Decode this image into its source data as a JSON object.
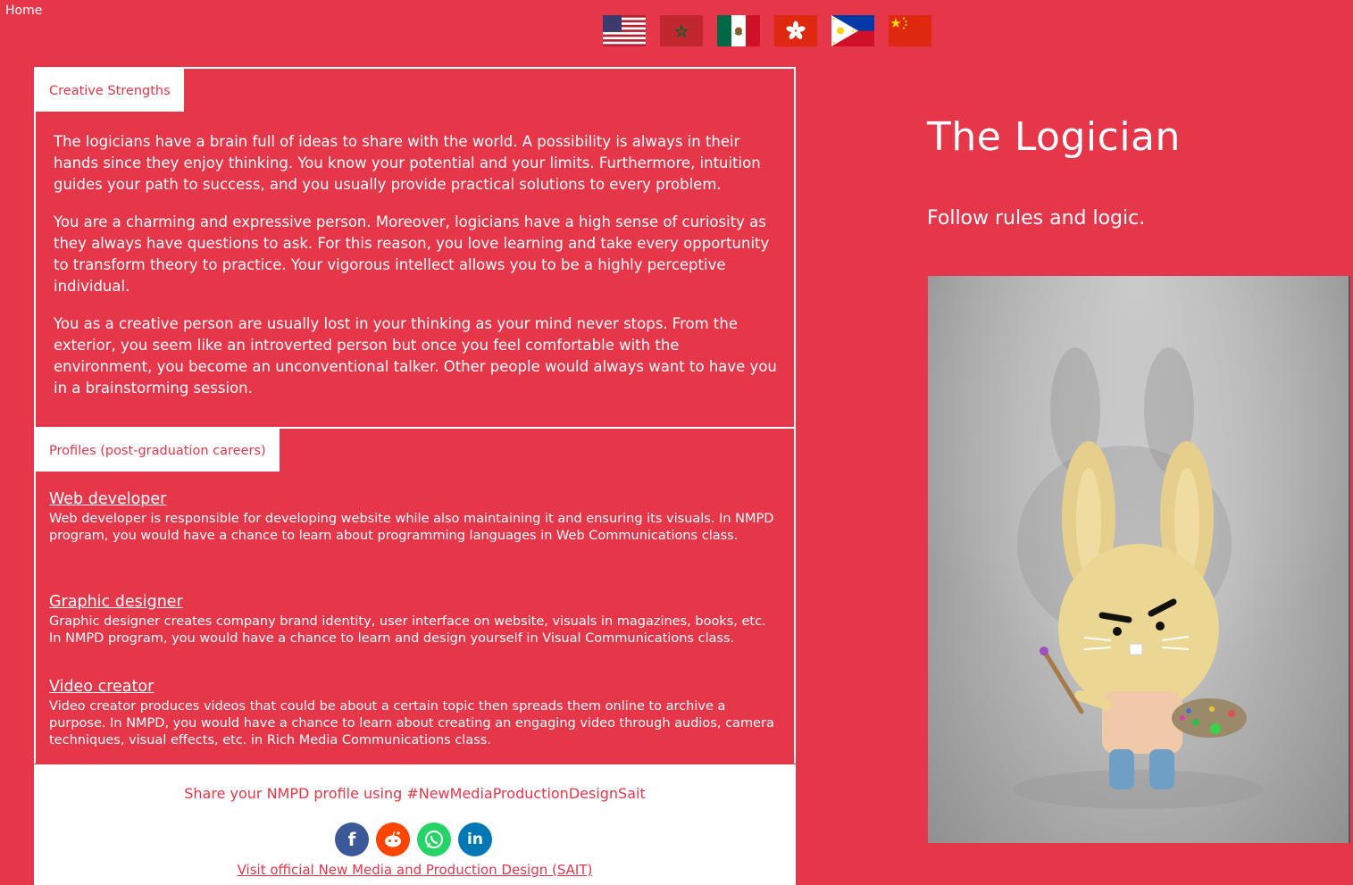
{
  "nav": {
    "home_label": "Home"
  },
  "flags": [
    {
      "name": "usa-flag-icon"
    },
    {
      "name": "morocco-flag-icon"
    },
    {
      "name": "mexico-flag-icon"
    },
    {
      "name": "hong-kong-flag-icon"
    },
    {
      "name": "philippines-flag-icon"
    },
    {
      "name": "china-flag-icon"
    }
  ],
  "strengths": {
    "tab_label": "Creative Strengths",
    "paragraphs": [
      "The logicians have a brain full of ideas to share with the world. A possibility is always in their hands since they enjoy thinking. You know your potential and your limits. Furthermore, intuition guides your path to success, and you usually provide practical solutions to every problem.",
      "You are a charming and expressive person. Moreover, logicians have a high sense of curiosity as they always have questions to ask. For this reason, you love learning and take every opportunity to transform theory to practice. Your vigorous intellect allows you to be a highly perceptive individual.",
      "You as a creative person are usually lost in your thinking as your mind never stops. From the exterior, you seem like an introverted person but once you feel comfortable with the environment, you become an unconventional talker. Other people would always want to have you in a brainstorming session."
    ]
  },
  "profiles": {
    "tab_label": "Profiles (post-graduation careers)",
    "items": [
      {
        "title": "Web developer",
        "description": "Web developer is responsible for developing website while also maintaining it and ensuring its visuals. In NMPD program, you would have a chance to learn about programming languages in Web Communications class."
      },
      {
        "title": "Graphic designer",
        "description": "Graphic designer creates company brand identity, user interface on website, visuals in magazines, books, etc. In NMPD program, you would have a chance to learn and design yourself in Visual Communications class."
      },
      {
        "title": "Video creator",
        "description": "Video creator produces videos that could be about a certain topic then spreads them online to archive a purpose. In NMPD, you would have a chance to learn about creating an engaging video through audios, camera techniques, visual effects, etc. in Rich Media Communications class."
      }
    ]
  },
  "share": {
    "text": "Share your NMPD profile using #NewMediaProductionDesignSait",
    "social": [
      {
        "icon": "facebook-icon",
        "glyph": "f",
        "color": "#3b5998"
      },
      {
        "icon": "reddit-icon",
        "glyph": "",
        "color": "#ff4500"
      },
      {
        "icon": "whatsapp-icon",
        "glyph": "",
        "color": "#25d366"
      },
      {
        "icon": "linkedin-icon",
        "glyph": "in",
        "color": "#0077b5"
      }
    ],
    "visit_link": "Visit official New Media and Production Design (SAIT)"
  },
  "hero": {
    "title": "The Logician",
    "subtitle": "Follow rules and logic."
  },
  "colors": {
    "accent": "#e5364a",
    "panel": "#ffffff"
  }
}
